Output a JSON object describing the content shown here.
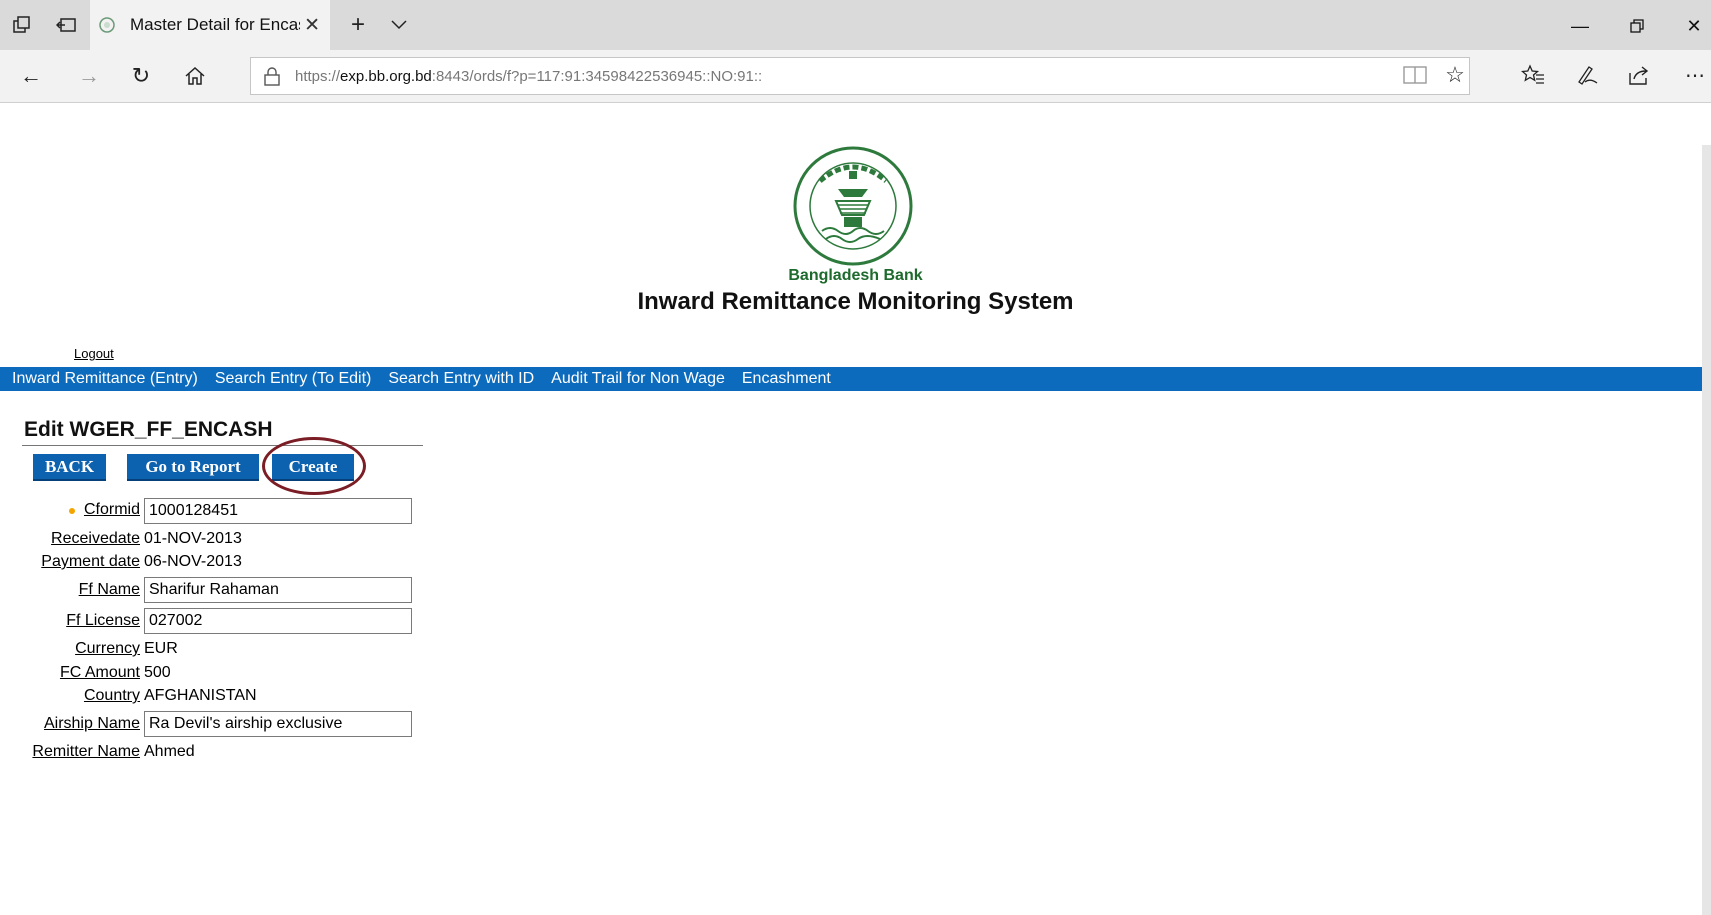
{
  "browser": {
    "tab_title": "Master Detail for Encash",
    "url_prefix": "https://",
    "url_host": "exp.bb.org.bd",
    "url_rest": ":8443/ords/f?p=117:91:34598422536945::NO:91::"
  },
  "header": {
    "bank_name": "Bangladesh Bank",
    "system_title": "Inward Remittance Monitoring System",
    "logout_label": "Logout"
  },
  "menu": {
    "items": [
      {
        "label": "Inward Remittance (Entry)"
      },
      {
        "label": "Search Entry (To Edit)"
      },
      {
        "label": "Search Entry with ID"
      },
      {
        "label": "Audit Trail for Non Wage"
      },
      {
        "label": "Encashment"
      }
    ]
  },
  "form": {
    "title": "Edit WGER_FF_ENCASH",
    "buttons": {
      "back": "BACK",
      "go_to_report": "Go to Report",
      "create": "Create"
    },
    "fields": {
      "cformid": {
        "label": "Cformid",
        "value": "1000128451"
      },
      "receivedate": {
        "label": "Receivedate",
        "value": "01-NOV-2013"
      },
      "payment_date": {
        "label": "Payment date",
        "value": "06-NOV-2013"
      },
      "ff_name": {
        "label": "Ff Name",
        "value": "Sharifur Rahaman"
      },
      "ff_license": {
        "label": "Ff License",
        "value": "027002"
      },
      "currency": {
        "label": "Currency",
        "value": "EUR"
      },
      "fc_amount": {
        "label": "FC Amount",
        "value": "500"
      },
      "country": {
        "label": "Country",
        "value": "AFGHANISTAN"
      },
      "airship_name": {
        "label": "Airship Name",
        "value": "Ra Devil's airship exclusive"
      },
      "remitter_name": {
        "label": "Remitter Name",
        "value": "Ahmed"
      }
    }
  },
  "colors": {
    "menu_bar": "#0d6bbd",
    "button": "#0d62b0",
    "highlight_ring": "#7b1d24",
    "bank_green": "#1d6a2c",
    "required_marker": "#f4a500"
  }
}
